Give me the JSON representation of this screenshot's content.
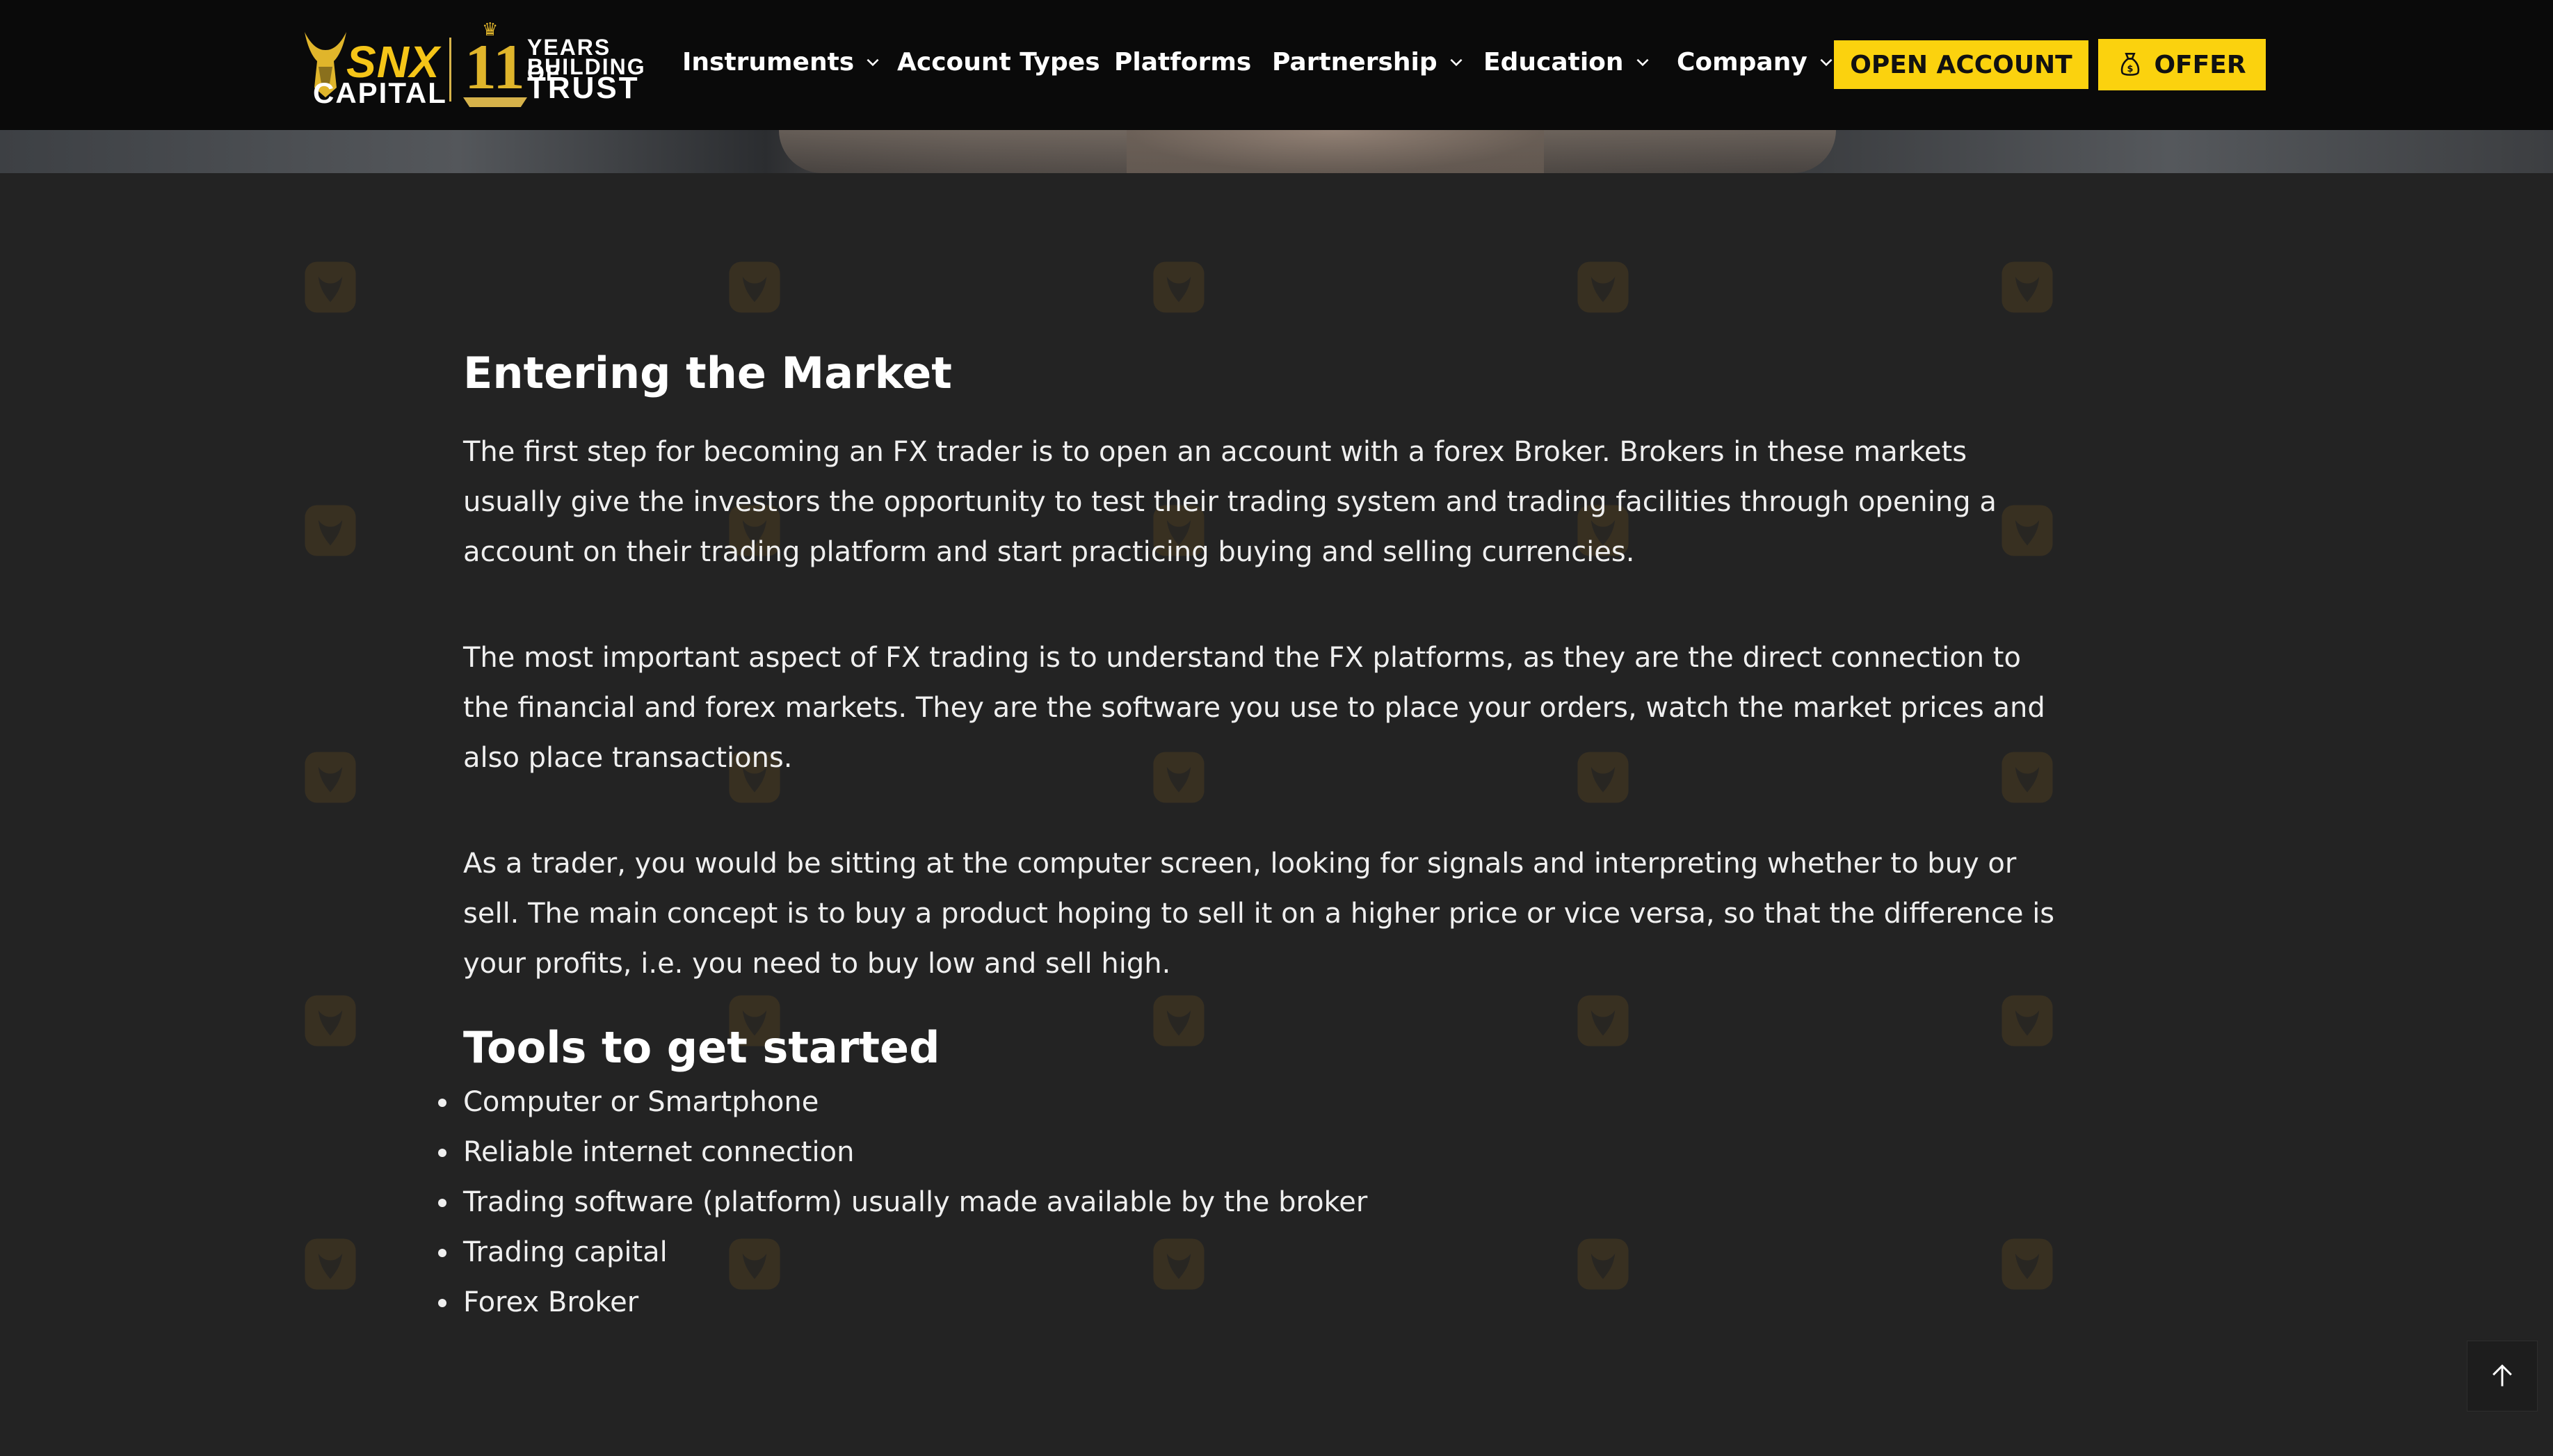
{
  "brand": {
    "logo_name": "SNX",
    "logo_sub": "CAPITAL",
    "years_number": "11",
    "years_line1": "YEARS OF",
    "years_line2": "BUILDING",
    "years_line3": "TRUST",
    "accent_color": "#fbd20e"
  },
  "nav": {
    "items": [
      {
        "label": "Instruments",
        "has_dropdown": true
      },
      {
        "label": "Account Types",
        "has_dropdown": false
      },
      {
        "label": "Platforms",
        "has_dropdown": false
      },
      {
        "label": "Partnership",
        "has_dropdown": true
      },
      {
        "label": "Education",
        "has_dropdown": true
      },
      {
        "label": "Company",
        "has_dropdown": true
      }
    ],
    "open_account_label": "OPEN ACCOUNT",
    "offer_label": "OFFER"
  },
  "article": {
    "heading1": "Entering the Market",
    "paragraphs": [
      "The first step for becoming an FX trader is to open an account with a forex Broker. Brokers in these markets usually give the investors the opportunity to test their trading system and trading facilities through opening a account on their trading platform and start practicing buying and selling currencies.",
      "The most important aspect of FX trading is to understand the FX platforms, as they are the direct connection to the financial and forex markets. They are the software you use to place your orders, watch the market prices and also place transactions.",
      "As a trader, you would be sitting at the computer screen, looking for signals and interpreting whether to buy or sell. The main concept is to buy a product hoping to sell it on a higher price or vice versa, so that the difference is your profits, i.e. you need to buy low and sell high."
    ],
    "heading2": "Tools to get started",
    "tools": [
      "Computer or Smartphone",
      "Reliable internet connection",
      "Trading software (platform) usually made available by the broker",
      "Trading capital",
      "Forex Broker"
    ]
  },
  "icons": {
    "scroll_top": "arrow-up-icon",
    "dropdown": "chevron-down-icon",
    "offer": "money-bag-icon",
    "watermark": "bull-logo-icon"
  }
}
